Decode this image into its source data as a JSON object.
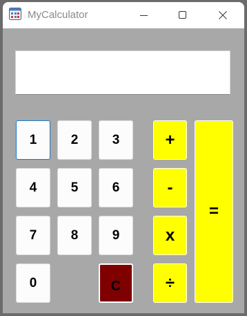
{
  "window": {
    "title": "MyCalculator"
  },
  "display": {
    "value": ""
  },
  "keys": {
    "one": "1",
    "two": "2",
    "three": "3",
    "four": "4",
    "five": "5",
    "six": "6",
    "seven": "7",
    "eight": "8",
    "nine": "9",
    "zero": "0",
    "clear": "C",
    "plus": "+",
    "minus": "-",
    "multiply": "x",
    "divide": "÷",
    "equals": "="
  },
  "colors": {
    "body_background": "#a8a8a8",
    "operator_key": "#ffff00",
    "clear_key": "#7f0000",
    "digit_key": "#fcfcfc",
    "focus_border": "#1a78c8"
  },
  "icons": [
    "app-icon",
    "minimize-icon",
    "maximize-icon",
    "close-icon"
  ]
}
